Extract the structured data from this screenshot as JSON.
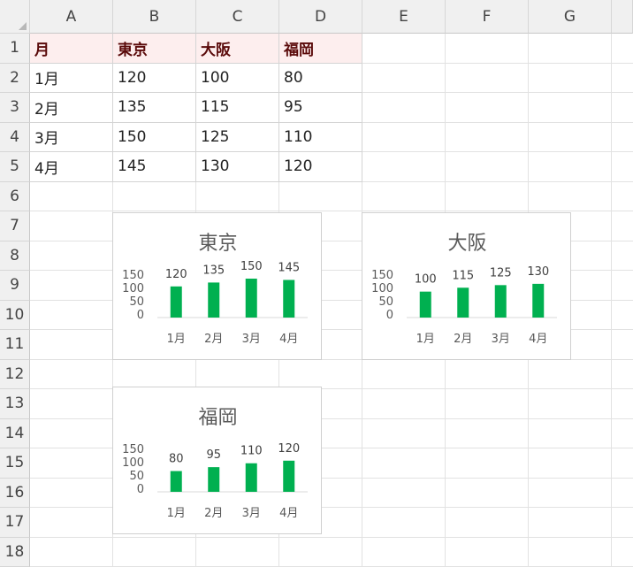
{
  "sheet": {
    "columns": [
      "A",
      "B",
      "C",
      "D",
      "E",
      "F",
      "G"
    ],
    "rows": [
      "1",
      "2",
      "3",
      "4",
      "5",
      "6",
      "7",
      "8",
      "9",
      "10",
      "11",
      "12",
      "13",
      "14",
      "15",
      "16",
      "17",
      "18"
    ],
    "table": {
      "header": [
        "月",
        "東京",
        "大阪",
        "福岡"
      ],
      "rows": [
        [
          "1月",
          "120",
          "100",
          "80"
        ],
        [
          "2月",
          "135",
          "115",
          "95"
        ],
        [
          "3月",
          "150",
          "125",
          "110"
        ],
        [
          "4月",
          "145",
          "130",
          "120"
        ]
      ]
    }
  },
  "colors": {
    "bar": "#00b050",
    "header_fill": "#fdeeee",
    "header_text": "#5a0a0a"
  },
  "chart_data": [
    {
      "type": "bar",
      "title": "東京",
      "categories": [
        "1月",
        "2月",
        "3月",
        "4月"
      ],
      "series": [
        {
          "values": [
            120,
            135,
            150,
            145
          ]
        }
      ],
      "yticks": [
        "150",
        "100",
        "50",
        "0"
      ],
      "ylim": [
        0,
        150
      ],
      "grid": false,
      "legend": "none"
    },
    {
      "type": "bar",
      "title": "大阪",
      "categories": [
        "1月",
        "2月",
        "3月",
        "4月"
      ],
      "series": [
        {
          "values": [
            100,
            115,
            125,
            130
          ]
        }
      ],
      "yticks": [
        "150",
        "100",
        "50",
        "0"
      ],
      "ylim": [
        0,
        150
      ],
      "grid": false,
      "legend": "none"
    },
    {
      "type": "bar",
      "title": "福岡",
      "categories": [
        "1月",
        "2月",
        "3月",
        "4月"
      ],
      "series": [
        {
          "values": [
            80,
            95,
            110,
            120
          ]
        }
      ],
      "yticks": [
        "150",
        "100",
        "50",
        "0"
      ],
      "ylim": [
        0,
        150
      ],
      "grid": false,
      "legend": "none"
    }
  ]
}
